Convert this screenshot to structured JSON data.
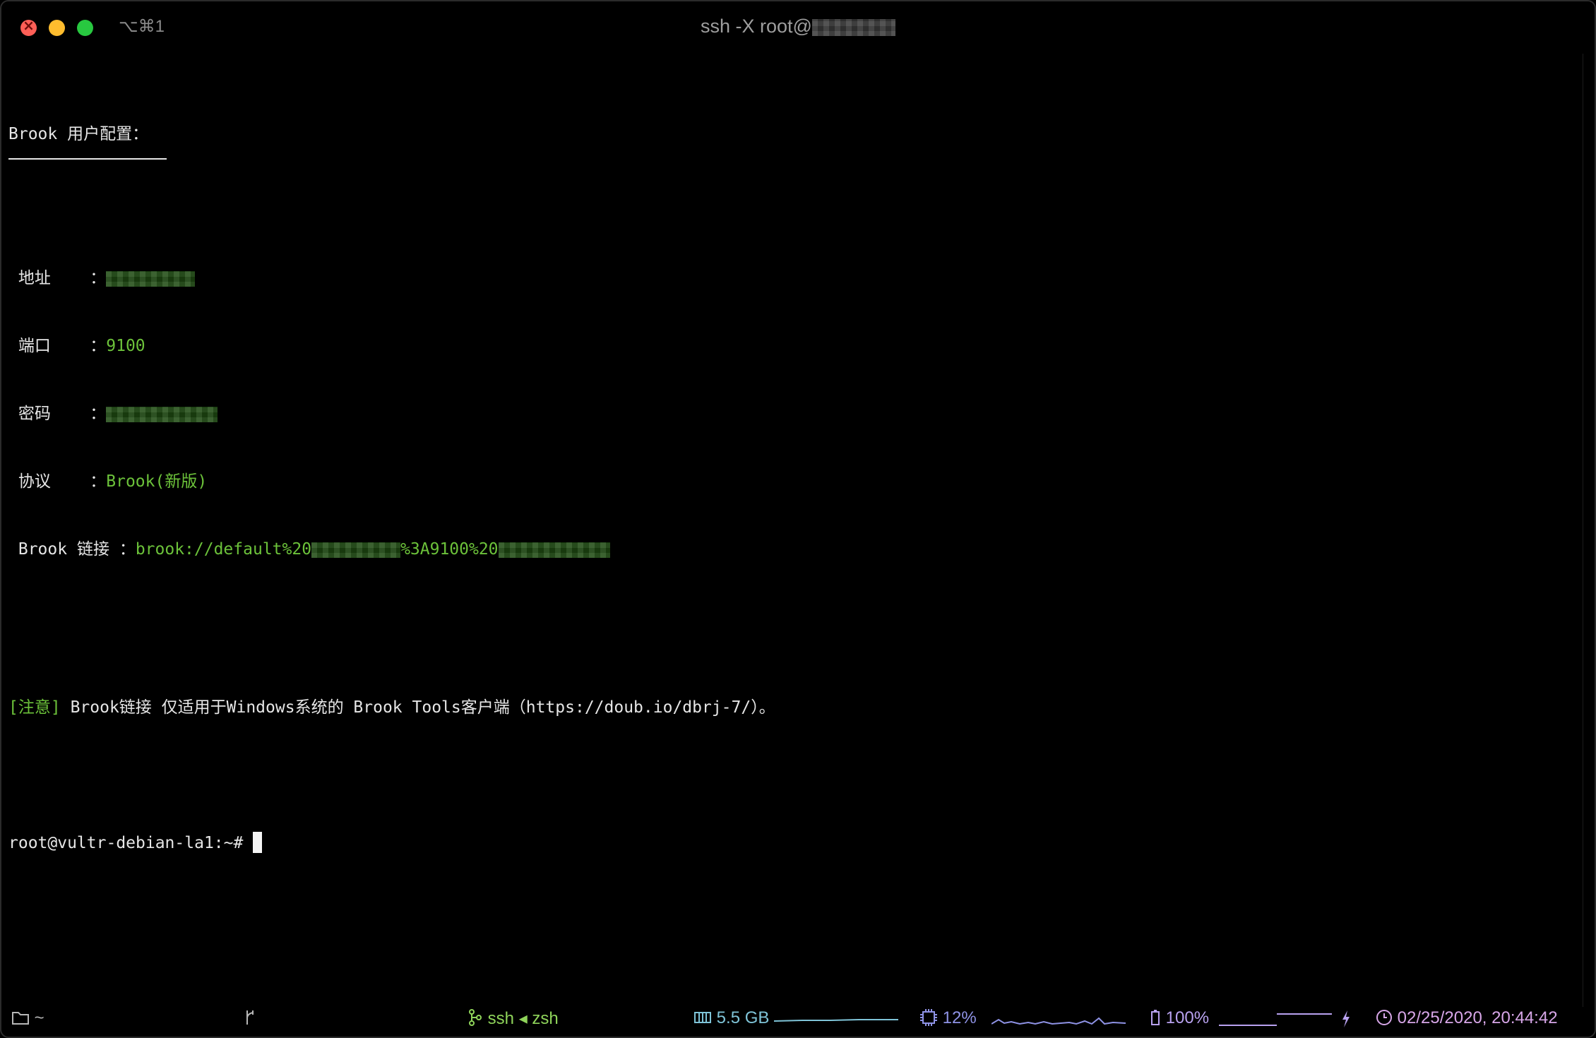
{
  "window": {
    "shortcut": "⌥⌘1",
    "title_prefix": "ssh -X root@"
  },
  "terminal": {
    "heading": "Brook 用户配置：",
    "rows": [
      {
        "label": "地址",
        "sep": "：",
        "value": ""
      },
      {
        "label": "端口",
        "sep": "：",
        "value": "9100"
      },
      {
        "label": "密码",
        "sep": "：",
        "value": ""
      },
      {
        "label": "协议",
        "sep": "：",
        "value": "Brook(新版)"
      },
      {
        "label": "Brook 链接",
        "sep": "：",
        "value_prefix": "brook://default%20",
        "value_middle": "%3A9100%20"
      }
    ],
    "note_tag": "[注意]",
    "note_text": "Brook链接 仅适用于Windows系统的 Brook Tools客户端（https://doub.io/dbrj-7/）。",
    "prompt": "root@vultr-debian-la1:~# "
  },
  "statusbar": {
    "folder_icon": "folder-icon",
    "folder_path": "~",
    "git_icon": "git-branch-icon",
    "job_icon": "process-icon",
    "job_text": "ssh ◂ zsh",
    "memory_icon": "memory-icon",
    "memory_text": "5.5 GB",
    "cpu_icon": "cpu-icon",
    "cpu_text": "12%",
    "battery_icon": "battery-icon",
    "battery_text": "100%",
    "charging_icon": "bolt-icon",
    "clock_icon": "clock-icon",
    "datetime": "02/25/2020, 20:44:42"
  },
  "colors": {
    "background": "#000000",
    "text": "#e6e6e6",
    "value_green": "#6cc23a",
    "job": "#8fd45a",
    "memory": "#7fc4d8",
    "cpu": "#8f93e6",
    "battery": "#b9a2f0",
    "clock": "#d7a6e8"
  }
}
